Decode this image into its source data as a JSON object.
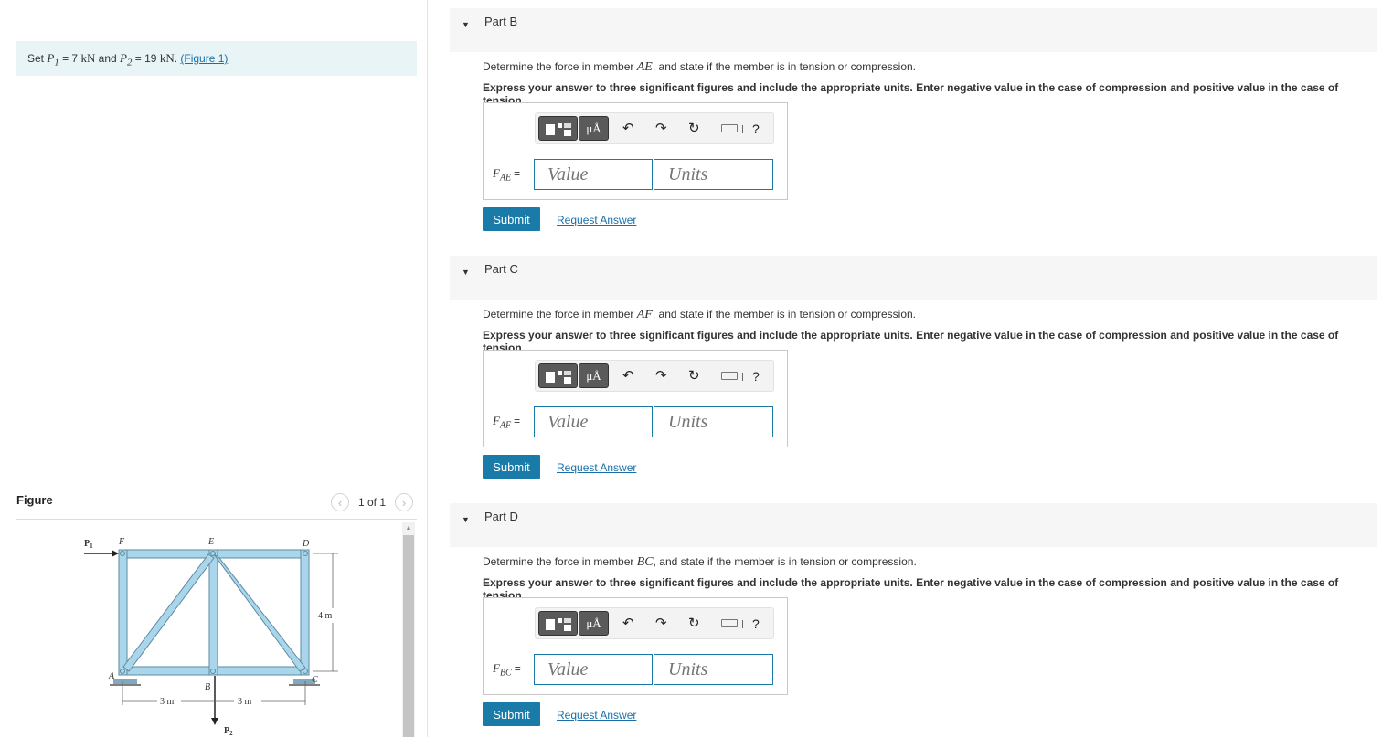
{
  "problem": {
    "set_prefix": "Set",
    "p1_sym": "P",
    "p1_sub": "1",
    "p1_value": "= 7",
    "p1_unit": "kN",
    "and_text": "and",
    "p2_sym": "P",
    "p2_sub": "2",
    "p2_value": "= 19",
    "p2_unit": "kN",
    "period": ".",
    "figure_link": "(Figure 1)"
  },
  "figure_panel": {
    "title": "Figure",
    "pager_text": "1 of 1",
    "prev_icon": "‹",
    "next_icon": "›",
    "labels": {
      "p1": "P",
      "p1_sub": "1",
      "p2": "P",
      "p2_sub": "2",
      "a": "A",
      "b": "B",
      "c": "C",
      "d": "D",
      "e": "E",
      "f": "F",
      "dim_left": "3 m",
      "dim_right": "3 m",
      "dim_height": "4 m"
    }
  },
  "parts": [
    {
      "title": "Part B",
      "question_pre": "Determine the force in member",
      "member": "AE",
      "question_post": ", and state if the member is in tension or compression.",
      "instruction": "Express your answer to three significant figures and include the appropriate units. Enter negative value in the case of compression and positive value in the case of tension.",
      "var_sym": "F",
      "var_sub": "AE",
      "equals": "=",
      "value_placeholder": "Value",
      "units_placeholder": "Units",
      "submit": "Submit",
      "request": "Request Answer"
    },
    {
      "title": "Part C",
      "question_pre": "Determine the force in member",
      "member": "AF",
      "question_post": ", and state if the member is in tension or compression.",
      "instruction": "Express your answer to three significant figures and include the appropriate units. Enter negative value in the case of compression and positive value in the case of tension.",
      "var_sym": "F",
      "var_sub": "AF",
      "equals": "=",
      "value_placeholder": "Value",
      "units_placeholder": "Units",
      "submit": "Submit",
      "request": "Request Answer"
    },
    {
      "title": "Part D",
      "question_pre": "Determine the force in member",
      "member": "BC",
      "question_post": ", and state if the member is in tension or compression.",
      "instruction": "Express your answer to three significant figures and include the appropriate units. Enter negative value in the case of compression and positive value in the case of tension.",
      "var_sym": "F",
      "var_sub": "BC",
      "equals": "=",
      "value_placeholder": "Value",
      "units_placeholder": "Units",
      "submit": "Submit",
      "request": "Request Answer"
    }
  ],
  "toolbar": {
    "units_label": "μÅ",
    "help_label": "?",
    "undo_icon": "↶",
    "redo_icon": "↷",
    "reset_icon": "↻",
    "icons": [
      "templates-icon",
      "units-icon",
      "undo-icon",
      "redo-icon",
      "reset-icon",
      "keyboard-icon",
      "help-icon"
    ]
  },
  "colors": {
    "accent": "#1a7aa8",
    "link": "#1a6fa8",
    "given_bg": "#e8f4f6",
    "part_header_bg": "#f6f6f6",
    "truss_member": "#a9d6ea"
  }
}
